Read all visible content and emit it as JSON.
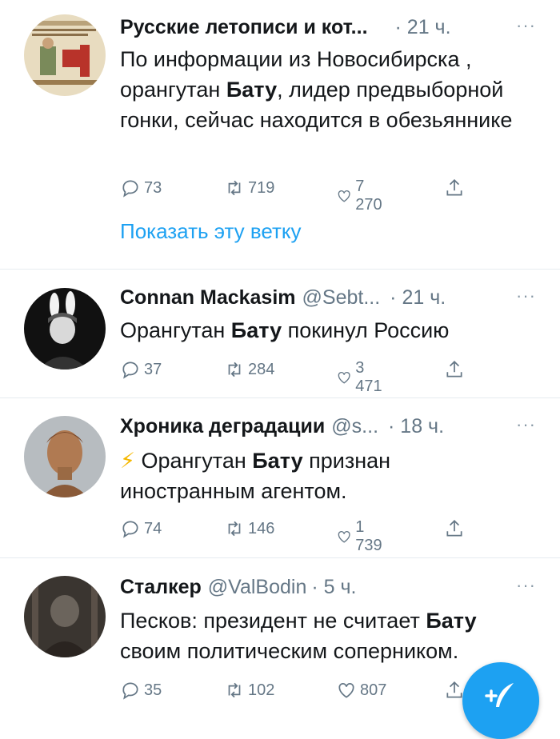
{
  "tweets": [
    {
      "name": "Русские летописи и кот...",
      "handle": "",
      "time": "· 21 ч.",
      "more": "···",
      "text_parts": [
        "По информации из Новосибирска , орангутан ",
        "Бату",
        ", лидер предвыборной гонки, сейчас находится в обезьяннике"
      ],
      "replies": "73",
      "retweets": "719",
      "likes": "7 270",
      "show_thread": "Показать эту ветку"
    },
    {
      "name": "Connan Mackasim",
      "handle": "@Sebt...",
      "time": "· 21 ч.",
      "more": "···",
      "text_parts": [
        "Орангутан ",
        "Бату",
        " покинул Россию"
      ],
      "replies": "37",
      "retweets": "284",
      "likes": "3 471"
    },
    {
      "name": "Хроника деградации",
      "handle": "@s...",
      "time": "· 18 ч.",
      "more": "···",
      "emoji": "⚡",
      "text_parts": [
        " Орангутан ",
        "Бату",
        " признан иностранным агентом."
      ],
      "replies": "74",
      "retweets": "146",
      "likes": "1 739"
    },
    {
      "name": "Сталкер",
      "handle": "@ValBodin",
      "time": "· 5 ч.",
      "more": "···",
      "text_parts": [
        "Песков: президент не считает ",
        "Бату",
        " своим  политическим соперником."
      ],
      "replies": "35",
      "retweets": "102",
      "likes": "807"
    }
  ],
  "colors": {
    "accent": "#1da1f2",
    "secondary_text": "#657786",
    "separator": "#e6ecf0"
  },
  "icons": {
    "reply": "reply-icon",
    "retweet": "retweet-icon",
    "like": "like-icon",
    "share": "share-icon",
    "compose": "compose-tweet-icon"
  }
}
